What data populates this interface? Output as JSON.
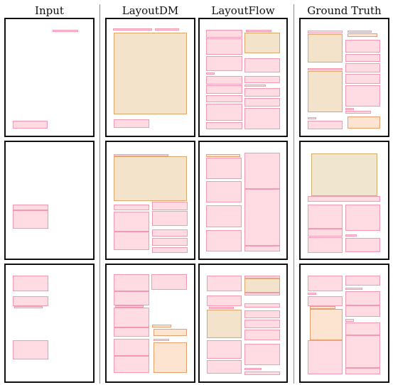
{
  "columns": [
    "Input",
    "LayoutDM",
    "LayoutFlow",
    "Ground Truth"
  ],
  "colors": {
    "pink": "#f39ab0",
    "beige": "#d9a86a",
    "peach": "#e7a06d",
    "khaki": "#cfae6e",
    "frame": "#111111",
    "separator": "#8a8a8a"
  },
  "grid": {
    "rows": 3,
    "cols": 4
  }
}
